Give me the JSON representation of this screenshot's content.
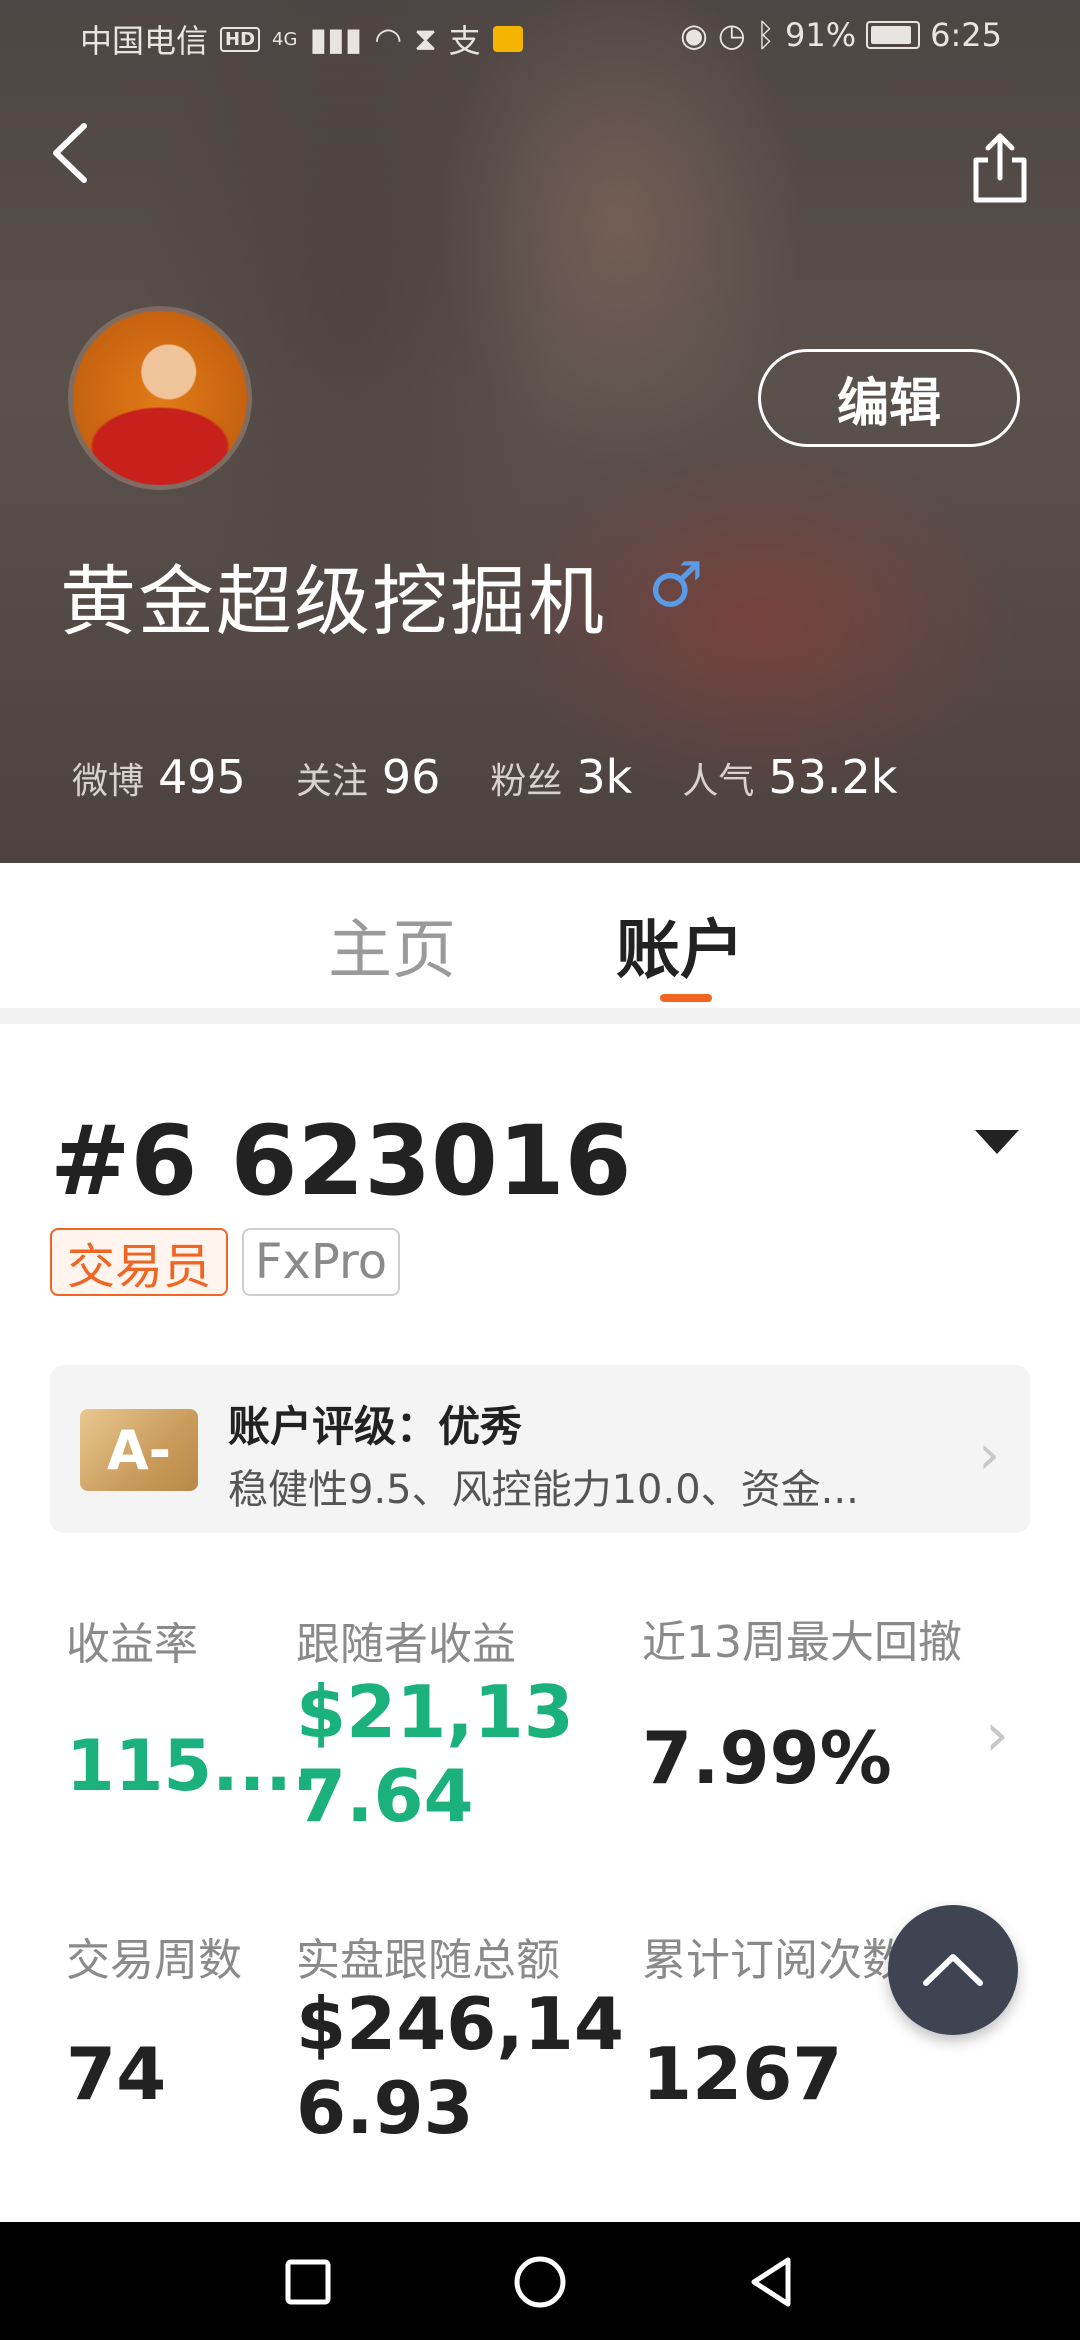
{
  "status_bar": {
    "carrier": "中国电信",
    "hd": "HD",
    "network": "4G",
    "battery": "91%",
    "time": "6:25"
  },
  "profile": {
    "edit_label": "编辑",
    "name": "黄金超级挖掘机",
    "gender_symbol": "♂",
    "stats": [
      {
        "label": "微博",
        "value": "495"
      },
      {
        "label": "关注",
        "value": "96"
      },
      {
        "label": "粉丝",
        "value": "3k"
      },
      {
        "label": "人气",
        "value": "53.2k"
      }
    ]
  },
  "tabs": [
    {
      "label": "主页",
      "active": false
    },
    {
      "label": "账户",
      "active": true
    }
  ],
  "account": {
    "number": "#6 623016",
    "tags": [
      "交易员",
      "FxPro"
    ],
    "rating": {
      "badge": "A-",
      "title": "账户评级：优秀",
      "desc": "稳健性9.5、风控能力10.0、资金..."
    },
    "metrics": [
      {
        "label": "收益率",
        "value": "115...."
      },
      {
        "label": "跟随者收益",
        "value": "$21,137.64"
      },
      {
        "label": "近13周最大回撤",
        "value": "7.99%"
      },
      {
        "label": "交易周数",
        "value": "74"
      },
      {
        "label": "实盘跟随总额",
        "value": "$246,146.93"
      },
      {
        "label": "累计订阅次数",
        "value": "1267"
      }
    ]
  },
  "colors": {
    "accent": "#f06522",
    "positive": "#1bb17d",
    "male": "#5b9be6"
  }
}
